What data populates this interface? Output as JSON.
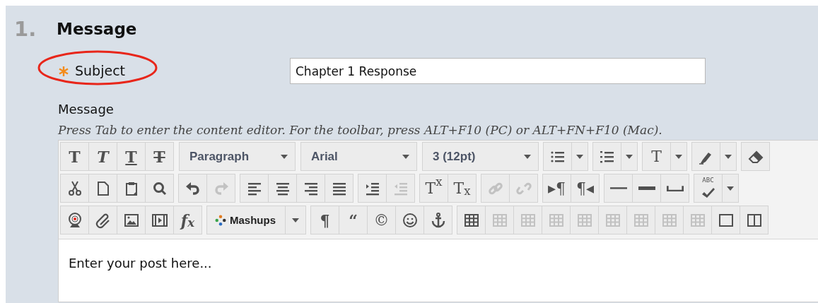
{
  "section": {
    "number": "1.",
    "title": "Message"
  },
  "subject": {
    "label": "Subject",
    "required": true,
    "value": "Chapter 1 Response"
  },
  "message": {
    "label": "Message",
    "instructions": "Press Tab to enter the content editor. For the toolbar, press ALT+F10 (PC) or ALT+FN+F10 (Mac)."
  },
  "toolbar": {
    "rows": [
      [
        {
          "kind": "group",
          "buttons": [
            {
              "glyph": "T",
              "disabled": false
            },
            {
              "glyph": "T",
              "disabled": false
            },
            {
              "glyph": "T",
              "disabled": false
            },
            {
              "glyph": "T",
              "disabled": false
            }
          ]
        },
        {
          "kind": "select",
          "label": "Paragraph"
        },
        {
          "kind": "select",
          "label": "Arial"
        },
        {
          "kind": "select",
          "label": "3 (12pt)"
        },
        {
          "kind": "split",
          "disabled": false
        },
        {
          "kind": "split",
          "disabled": false
        },
        {
          "kind": "split",
          "glyph": "T",
          "disabled": false
        },
        {
          "kind": "split",
          "disabled": false
        },
        {
          "kind": "group",
          "buttons": [
            {
              "disabled": false
            }
          ]
        }
      ],
      [
        {
          "kind": "group",
          "buttons": [
            {
              "disabled": false
            },
            {
              "disabled": false
            },
            {
              "disabled": false
            },
            {
              "disabled": false
            }
          ]
        },
        {
          "kind": "group",
          "buttons": [
            {
              "disabled": false
            },
            {
              "disabled": true
            }
          ]
        },
        {
          "kind": "group",
          "buttons": [
            {
              "disabled": false
            },
            {
              "disabled": false
            },
            {
              "disabled": false
            },
            {
              "disabled": false
            }
          ]
        },
        {
          "kind": "group",
          "buttons": [
            {
              "disabled": false
            },
            {
              "disabled": true
            }
          ]
        },
        {
          "kind": "group",
          "buttons": [
            {
              "glyph": "T$^{x}$",
              "disabled": false
            },
            {
              "glyph": "T$_{x}$",
              "disabled": false
            }
          ]
        },
        {
          "kind": "group",
          "buttons": [
            {
              "disabled": true
            },
            {
              "disabled": true
            }
          ]
        },
        {
          "kind": "group",
          "buttons": [
            {
              "glyph": "▸¶",
              "disabled": false
            },
            {
              "glyph": "¶◂",
              "disabled": false
            }
          ]
        },
        {
          "kind": "group",
          "buttons": [
            {
              "disabled": false
            },
            {
              "disabled": false
            },
            {
              "disabled": false
            }
          ]
        },
        {
          "kind": "split",
          "caption": "ABC",
          "disabled": false
        }
      ],
      [
        {
          "kind": "group",
          "buttons": [
            {
              "disabled": false
            },
            {
              "disabled": false
            },
            {
              "disabled": false
            },
            {
              "disabled": false
            },
            {
              "glyph": "f$_{x}$",
              "disabled": false
            }
          ]
        },
        {
          "kind": "menu",
          "label": "Mashups"
        },
        {
          "kind": "group",
          "buttons": [
            {
              "glyph": "¶",
              "disabled": false
            },
            {
              "glyph": "“",
              "disabled": false
            },
            {
              "glyph": "©",
              "disabled": false
            },
            {
              "disabled": false
            },
            {
              "disabled": false
            }
          ]
        },
        {
          "kind": "group",
          "buttons": [
            {
              "disabled": false
            },
            {
              "disabled": true
            },
            {
              "disabled": true
            },
            {
              "disabled": true
            },
            {
              "disabled": true
            },
            {
              "disabled": true
            },
            {
              "disabled": true
            },
            {
              "disabled": true
            },
            {
              "disabled": true
            },
            {
              "disabled": false
            },
            {
              "disabled": false
            }
          ]
        }
      ]
    ]
  },
  "editor": {
    "body_text": "Enter your post here..."
  }
}
